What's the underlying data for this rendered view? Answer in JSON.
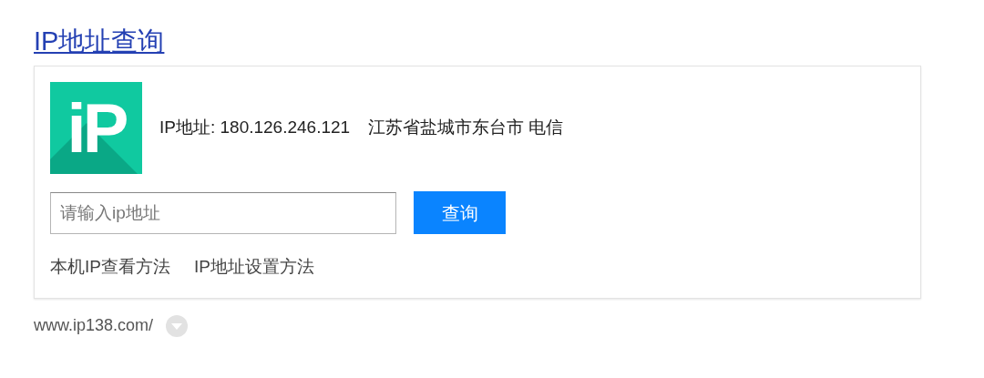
{
  "title": "IP地址查询",
  "result": {
    "logo_text": "iP",
    "ip": "IP地址: 180.126.246.121",
    "location": "江苏省盐城市东台市 电信"
  },
  "search": {
    "placeholder": "请输入ip地址",
    "button": "查询"
  },
  "links": [
    "本机IP查看方法",
    "IP地址设置方法"
  ],
  "url": "www.ip138.com/"
}
